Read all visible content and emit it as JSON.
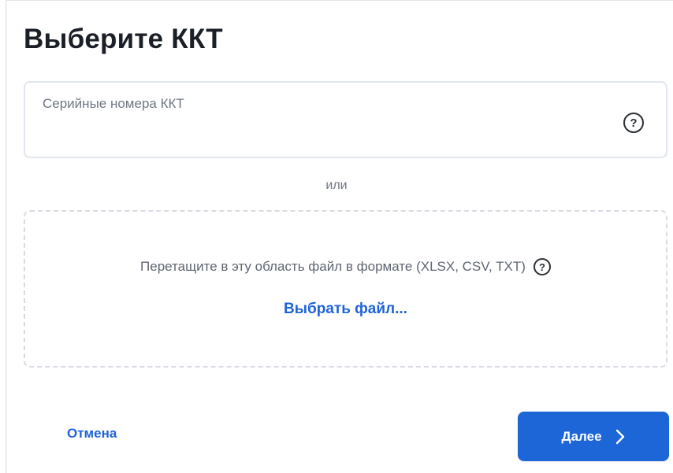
{
  "dialog": {
    "title": "Выберите ККТ",
    "serial_field": {
      "placeholder": "Серийные номера ККТ",
      "help_glyph": "?",
      "help_icon": "question-circle-icon"
    },
    "separator_text": "или",
    "dropzone": {
      "hint": "Перетащите в эту область файл в формате (XLSX, CSV, TXT)",
      "help_glyph": "?",
      "help_icon": "question-circle-icon",
      "choose_file_label": "Выбрать файл..."
    },
    "footer": {
      "cancel_label": "Отмена",
      "next_label": "Далее",
      "next_icon": "chevron-right-icon"
    }
  },
  "colors": {
    "accent": "#1d66d8",
    "link": "#1f63d6",
    "placeholder": "#707783",
    "border": "#e1e5ee"
  }
}
